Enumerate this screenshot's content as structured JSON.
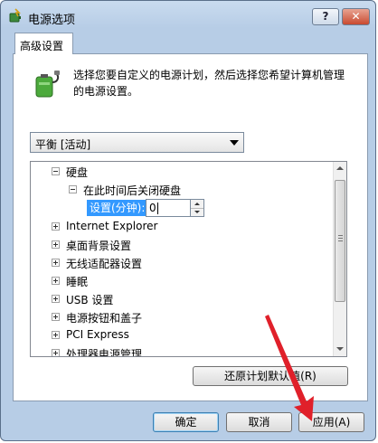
{
  "window": {
    "title": "电源选项",
    "help_label": "?",
    "close_label": "✕"
  },
  "tabs": [
    {
      "label": "高级设置"
    }
  ],
  "description": "选择您要自定义的电源计划，然后选择您希望计算机管理的电源设置。",
  "plan_select": {
    "value": "平衡 [活动]"
  },
  "tree": {
    "items": [
      {
        "label": "硬盘"
      },
      {
        "label": "在此时间后关闭硬盘"
      },
      {
        "label": "Internet Explorer"
      },
      {
        "label": "桌面背景设置"
      },
      {
        "label": "无线适配器设置"
      },
      {
        "label": "睡眠"
      },
      {
        "label": "USB 设置"
      },
      {
        "label": "电源按钮和盖子"
      },
      {
        "label": "PCI Express"
      },
      {
        "label": "处理器电源管理"
      }
    ],
    "setting": {
      "label": "设置(分钟):",
      "value": "0"
    }
  },
  "buttons": {
    "restore": "还原计划默认值(R)",
    "ok": "确定",
    "cancel": "取消",
    "apply": "应用(A)"
  },
  "colors": {
    "selection": "#3399ff",
    "annotation_arrow": "#e0202a"
  },
  "icons": [
    "power-options-icon",
    "battery-plug-icon",
    "chevron-down-icon",
    "spin-up-icon",
    "spin-down-icon",
    "close-icon",
    "help-icon"
  ]
}
